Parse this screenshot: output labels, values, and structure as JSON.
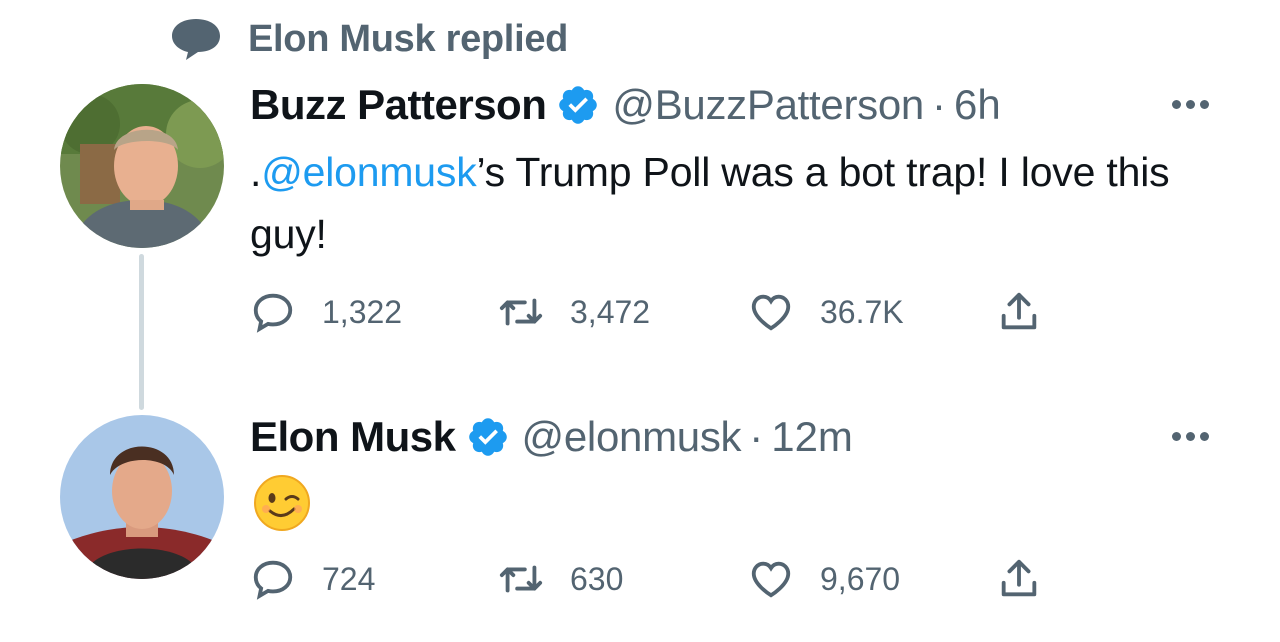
{
  "context": {
    "text": "Elon Musk replied"
  },
  "tweets": [
    {
      "name": "Buzz Patterson",
      "handle": "@BuzzPatterson",
      "separator": "·",
      "time": "6h",
      "text_prefix": ".",
      "mention": "@elonmusk",
      "text_rest": "’s Trump Poll was a bot trap! I love this guy!",
      "replies": "1,322",
      "retweets": "3,472",
      "likes": "36.7K"
    },
    {
      "name": "Elon Musk",
      "handle": "@elonmusk",
      "separator": "·",
      "time": "12m",
      "emoji": "winking-face",
      "replies": "724",
      "retweets": "630",
      "likes": "9,670"
    }
  ],
  "colors": {
    "accent": "#1d9bf0",
    "secondary_text": "#536471",
    "primary_text": "#0f1419",
    "thread_line": "#cfd9de"
  }
}
